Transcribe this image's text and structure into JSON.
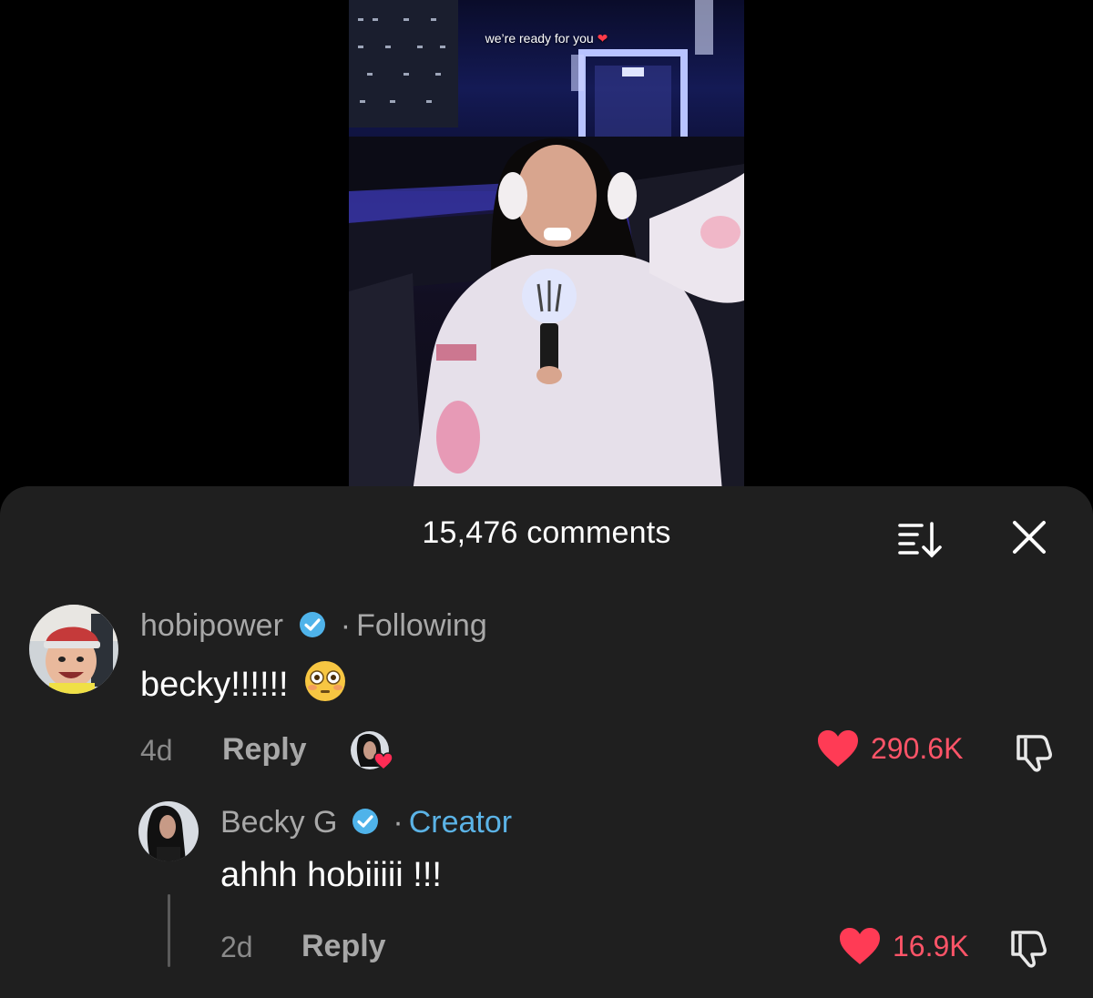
{
  "video": {
    "caption": "we’re ready for you",
    "caption_heart": "❤"
  },
  "comments_sheet": {
    "title": "15,476 comments",
    "sort_icon": "sort-icon",
    "close_icon": "close-icon",
    "accent_like": "#ff5468",
    "accent_creator": "#5bb3e6"
  },
  "comments": [
    {
      "username": "hobipower",
      "separator": "·",
      "relationship": "Following",
      "text": "becky!!!!!!",
      "emoji": "😳",
      "age": "4d",
      "reply_label": "Reply",
      "likes": "290.6K",
      "liked_by_creator": true
    }
  ],
  "replies": [
    {
      "username": "Becky G",
      "separator": "·",
      "badge": "Creator",
      "text": "ahhh hobiiiii !!!",
      "age": "2d",
      "reply_label": "Reply",
      "likes": "16.9K"
    }
  ]
}
